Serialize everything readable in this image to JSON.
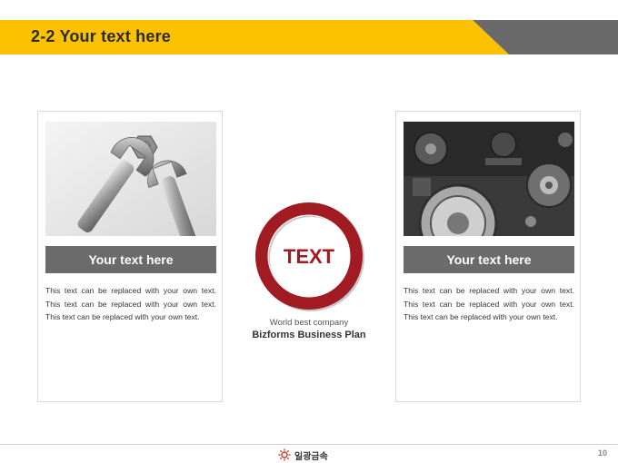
{
  "header": {
    "title": "2-2 Your text here"
  },
  "left_card": {
    "title": "Your text here",
    "body": "This text can be replaced with your own text. This text can be replaced with your own text. This text can be replaced with your own text."
  },
  "right_card": {
    "title": "Your text here",
    "body": "This text can be replaced with your own text. This text can be replaced with your own text. This text can be replaced with your own text."
  },
  "center": {
    "ring_text": "TEXT",
    "company": "World best company",
    "plan": "Bizforms Business Plan"
  },
  "footer": {
    "logo_text": "일광금속",
    "page_number": "10"
  },
  "colors": {
    "header_yellow": "#fcc100",
    "header_gray": "#6a6a6a",
    "accent_red": "#a11b22",
    "bar_gray": "#6b6b6b"
  }
}
